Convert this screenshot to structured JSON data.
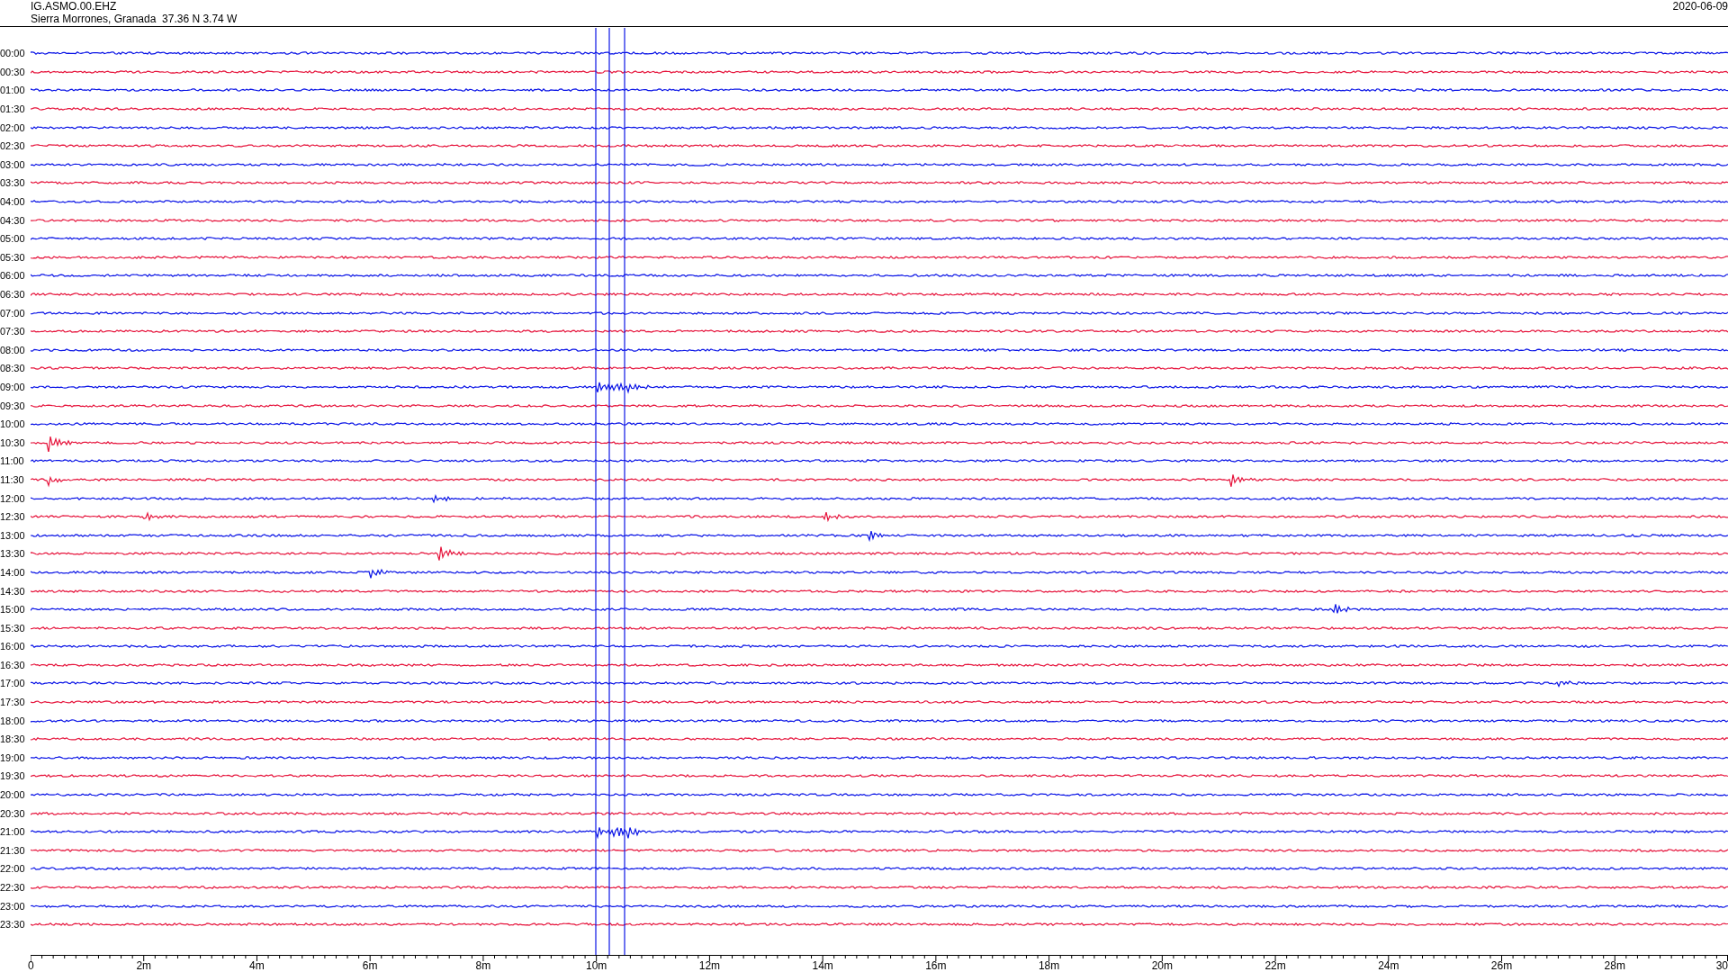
{
  "header": {
    "station": "IG.ASMO.00.EHZ",
    "location": "Sierra Morrones, Granada  37.36 N 3.74 W",
    "date": "2020-06-09"
  },
  "rows": [
    {
      "time": "00:00",
      "color": "#0a14e6"
    },
    {
      "time": "00:30",
      "color": "#e6143c"
    },
    {
      "time": "01:00",
      "color": "#0a14e6"
    },
    {
      "time": "01:30",
      "color": "#e6143c"
    },
    {
      "time": "02:00",
      "color": "#0a14e6"
    },
    {
      "time": "02:30",
      "color": "#e6143c"
    },
    {
      "time": "03:00",
      "color": "#0a14e6"
    },
    {
      "time": "03:30",
      "color": "#e6143c"
    },
    {
      "time": "04:00",
      "color": "#0a14e6"
    },
    {
      "time": "04:30",
      "color": "#e6143c"
    },
    {
      "time": "05:00",
      "color": "#0a14e6"
    },
    {
      "time": "05:30",
      "color": "#e6143c"
    },
    {
      "time": "06:00",
      "color": "#0a14e6"
    },
    {
      "time": "06:30",
      "color": "#e6143c"
    },
    {
      "time": "07:00",
      "color": "#0a14e6"
    },
    {
      "time": "07:30",
      "color": "#e6143c"
    },
    {
      "time": "08:00",
      "color": "#0a14e6"
    },
    {
      "time": "08:30",
      "color": "#e6143c"
    },
    {
      "time": "09:00",
      "color": "#0a14e6"
    },
    {
      "time": "09:30",
      "color": "#e6143c"
    },
    {
      "time": "10:00",
      "color": "#0a14e6"
    },
    {
      "time": "10:30",
      "color": "#e6143c"
    },
    {
      "time": "11:00",
      "color": "#0a14e6"
    },
    {
      "time": "11:30",
      "color": "#e6143c"
    },
    {
      "time": "12:00",
      "color": "#0a14e6"
    },
    {
      "time": "12:30",
      "color": "#e6143c"
    },
    {
      "time": "13:00",
      "color": "#0a14e6"
    },
    {
      "time": "13:30",
      "color": "#e6143c"
    },
    {
      "time": "14:00",
      "color": "#0a14e6"
    },
    {
      "time": "14:30",
      "color": "#e6143c"
    },
    {
      "time": "15:00",
      "color": "#0a14e6"
    },
    {
      "time": "15:30",
      "color": "#e6143c"
    },
    {
      "time": "16:00",
      "color": "#0a14e6"
    },
    {
      "time": "16:30",
      "color": "#e6143c"
    },
    {
      "time": "17:00",
      "color": "#0a14e6"
    },
    {
      "time": "17:30",
      "color": "#e6143c"
    },
    {
      "time": "18:00",
      "color": "#0a14e6"
    },
    {
      "time": "18:30",
      "color": "#e6143c"
    },
    {
      "time": "19:00",
      "color": "#0a14e6"
    },
    {
      "time": "19:30",
      "color": "#e6143c"
    },
    {
      "time": "20:00",
      "color": "#0a14e6"
    },
    {
      "time": "20:30",
      "color": "#e6143c"
    },
    {
      "time": "21:00",
      "color": "#0a14e6"
    },
    {
      "time": "21:30",
      "color": "#e6143c"
    },
    {
      "time": "22:00",
      "color": "#0a14e6"
    },
    {
      "time": "22:30",
      "color": "#e6143c"
    },
    {
      "time": "23:00",
      "color": "#0a14e6"
    },
    {
      "time": "23:30",
      "color": "#e6143c"
    }
  ],
  "x_axis": {
    "ticks": [
      "0",
      "2m",
      "4m",
      "6m",
      "8m",
      "10m",
      "12m",
      "14m",
      "16m",
      "18m",
      "20m",
      "22m",
      "24m",
      "26m",
      "28m",
      "30"
    ]
  }
}
